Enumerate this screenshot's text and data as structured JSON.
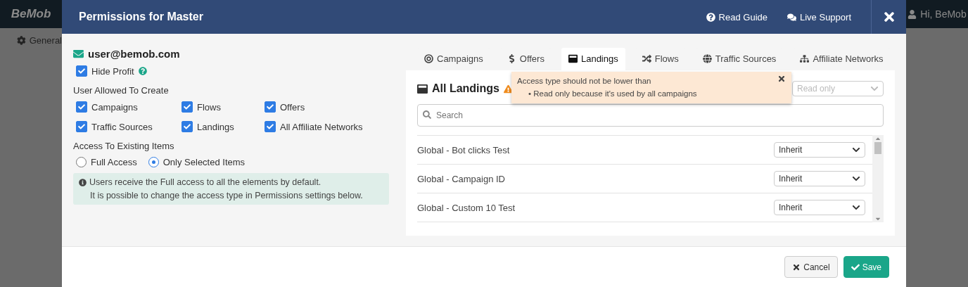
{
  "background": {
    "logo": "BeMob",
    "nav_item": "General",
    "user": "Hi, BeMob"
  },
  "window": {
    "title": "Permissions for Master"
  },
  "header_links": [
    {
      "label": "Read Guide",
      "kind": "guide"
    },
    {
      "label": "Live Support",
      "kind": "support"
    }
  ],
  "user_email": "user@bemob.com",
  "hide_profit": {
    "label": "Hide Profit",
    "checked": true
  },
  "create_section": {
    "title": "User Allowed To Create",
    "items": [
      {
        "label": "Campaigns",
        "checked": true
      },
      {
        "label": "Flows",
        "checked": true
      },
      {
        "label": "Offers",
        "checked": true
      },
      {
        "label": "Traffic Sources",
        "checked": true
      },
      {
        "label": "Landings",
        "checked": true
      },
      {
        "label": "All Affiliate Networks",
        "checked": true
      }
    ]
  },
  "access_section": {
    "title": "Access To Existing Items",
    "options": [
      {
        "label": "Full Access",
        "selected": false
      },
      {
        "label": "Only Selected Items",
        "selected": true
      }
    ]
  },
  "info": [
    "Users receive the Full access to all the elements by default.",
    "It is possible to change the access type in Permissions settings below."
  ],
  "tabs": [
    {
      "label": "Campaigns",
      "kind": "campaigns",
      "selected": false
    },
    {
      "label": "Offers",
      "kind": "offers",
      "selected": false
    },
    {
      "label": "Landings",
      "kind": "landings",
      "selected": true
    },
    {
      "label": "Flows",
      "kind": "flows",
      "selected": false
    },
    {
      "label": "Traffic Sources",
      "kind": "sources",
      "selected": false
    },
    {
      "label": "Affiliate Networks",
      "kind": "networks",
      "selected": false
    }
  ],
  "panel": {
    "title": "All Landings",
    "access_select": "Read only",
    "search_placeholder": "Search",
    "alert": {
      "title": "Access type should not be lower than",
      "items": [
        {
          "bullet": "•",
          "text": "Read only because it's used by all campaigns"
        }
      ]
    },
    "rows": [
      {
        "name": "Global - Bot clicks Test",
        "access": "Inherit"
      },
      {
        "name": "Global - Campaign ID",
        "access": "Inherit"
      },
      {
        "name": "Global - Custom 10 Test",
        "access": "Inherit"
      }
    ]
  },
  "buttons": [
    {
      "label": "Cancel",
      "kind": "cancel"
    },
    {
      "label": "Save",
      "kind": "save"
    }
  ]
}
